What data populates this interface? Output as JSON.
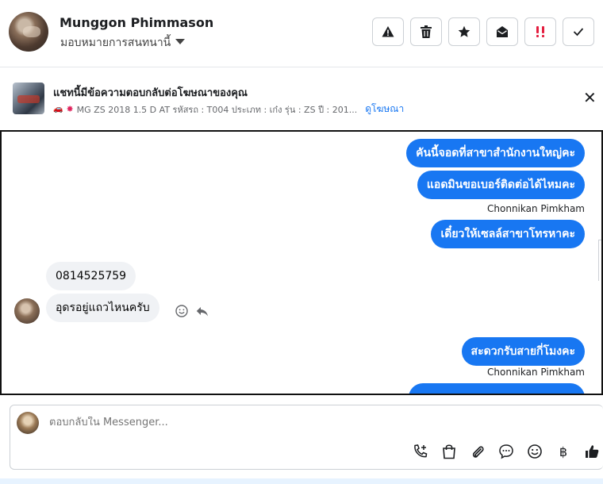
{
  "header": {
    "contact_name": "Munggon Phimmason",
    "assign_label": "มอบหมายการสนทนานี้",
    "actions": [
      {
        "name": "report-button",
        "icon": "warning-icon",
        "glyph": "⚠"
      },
      {
        "name": "delete-button",
        "icon": "trash-icon",
        "glyph": "🗑"
      },
      {
        "name": "star-button",
        "icon": "star-icon",
        "glyph": "★"
      },
      {
        "name": "mark-unread-button",
        "icon": "envelope-open-icon",
        "glyph": "✉"
      },
      {
        "name": "mark-important-button",
        "icon": "double-exclamation-icon",
        "glyph": "‼"
      },
      {
        "name": "mark-done-button",
        "icon": "check-icon",
        "glyph": "✓"
      }
    ]
  },
  "ad": {
    "title": "แชทนี้มีข้อความตอบกลับต่อโฆษณาของคุณ",
    "details": "MG ZS 2018 1.5 D AT รหัสรถ : T004 ประเภท : เก๋ง รุ่น : ZS ปี : 201...",
    "link_label": "ดูโฆษณา",
    "close_glyph": "✕"
  },
  "messages": [
    {
      "direction": "out",
      "text": "คันนี้จอดที่สาขาสำนักงานใหญ่คะ"
    },
    {
      "direction": "out",
      "text": "แอดมินขอเบอร์ติดต่อได้ไหมคะ"
    },
    {
      "direction": "sender",
      "text": "Chonnikan Pimkham"
    },
    {
      "direction": "out",
      "text": "เดี๋ยวให้เซลล์สาขาโทรหาคะ"
    },
    {
      "direction": "in",
      "text": "0814525759"
    },
    {
      "direction": "in",
      "text": "อุดรอยู่แถวไหนครับ"
    },
    {
      "direction": "out",
      "text": "สะดวกรับสายกี่โมงคะ"
    },
    {
      "direction": "sender",
      "text": "Chonnikan Pimkham"
    }
  ],
  "composer": {
    "placeholder": "ตอบกลับใน Messenger...",
    "baht_glyph": "฿"
  },
  "colors": {
    "accent": "#1877f2",
    "incoming_bubble": "#f0f2f5",
    "important": "#e41e3f"
  }
}
